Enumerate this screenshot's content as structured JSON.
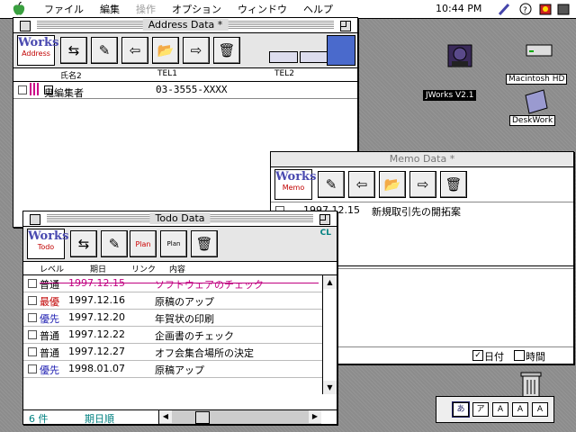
{
  "menubar": {
    "items": [
      "ファイル",
      "編集",
      "操作",
      "オプション",
      "ウィンドウ",
      "ヘルプ"
    ],
    "disabled_index": 2,
    "clock": "10:44 PM"
  },
  "desktop": {
    "icons": [
      {
        "label": "JWorks V2.1",
        "selected": true
      },
      {
        "label": "Macintosh HD",
        "selected": false
      },
      {
        "label": "DeskWork",
        "selected": false
      }
    ]
  },
  "address_window": {
    "title": "Address Data *",
    "logo": "Works",
    "logo_sub": "Address",
    "columns": [
      "氏名2",
      "TEL1",
      "TEL2"
    ],
    "rows": [
      {
        "name": "鬼編集者",
        "tel1": "03-3555-XXXX",
        "tel2": ""
      }
    ]
  },
  "memo_window": {
    "title": "Memo Data *",
    "logo": "Works",
    "logo_sub": "Memo",
    "rows": [
      {
        "date": "1997.12.15",
        "text": "新規取引先の開拓案"
      }
    ],
    "checkbox_date": "日付",
    "checkbox_time": "時間"
  },
  "todo_window": {
    "title": "Todo Data",
    "logo": "Works",
    "logo_sub": "Todo",
    "cl_badge": "CL",
    "plan_label": "Plan",
    "columns": [
      "レベル",
      "期日",
      "リンク",
      "内容"
    ],
    "rows": [
      {
        "level": "普通",
        "date": "1997.12.15",
        "content": "ソフトウェアのチェック",
        "done": true,
        "level_color": "#000000"
      },
      {
        "level": "最優",
        "date": "1997.12.16",
        "content": "原稿のアップ",
        "done": false,
        "level_color": "#c00000"
      },
      {
        "level": "優先",
        "date": "1997.12.20",
        "content": "年賀状の印刷",
        "done": false,
        "level_color": "#1a1ab0"
      },
      {
        "level": "普通",
        "date": "1997.12.22",
        "content": "企画書のチェック",
        "done": false,
        "level_color": "#000000"
      },
      {
        "level": "普通",
        "date": "1997.12.27",
        "content": "オフ会集合場所の決定",
        "done": false,
        "level_color": "#000000"
      },
      {
        "level": "優先",
        "date": "1998.01.07",
        "content": "原稿アップ",
        "done": false,
        "level_color": "#1a1ab0"
      }
    ],
    "status_count": "6 件",
    "status_sort": "期日順"
  },
  "palette": {
    "buttons": [
      "あ",
      "ア",
      "A",
      "A",
      "A"
    ]
  },
  "colors": {
    "done_strike": "#c00080",
    "accent_blue": "#4a4ab0",
    "logo_red": "#c00000",
    "status_teal": "#008080"
  }
}
